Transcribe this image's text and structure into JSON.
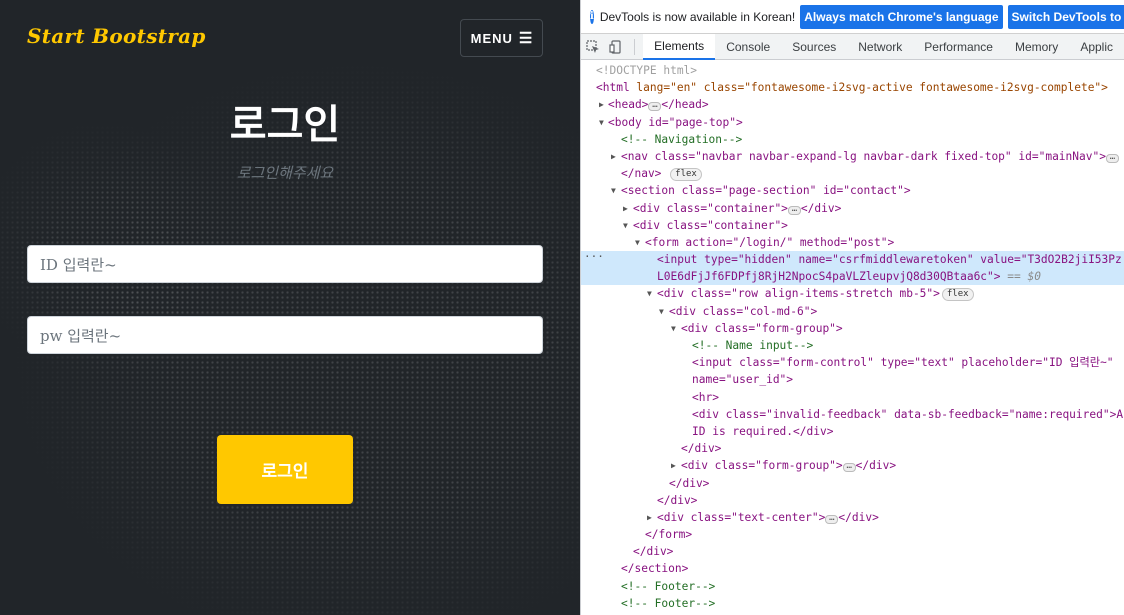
{
  "site": {
    "brand": "Start Bootstrap",
    "menu_label": "MENU",
    "menu_icon": "hamburger-icon",
    "title": "로그인",
    "subtitle": "로그인해주세요",
    "id_placeholder": "ID 입력란~",
    "pw_placeholder": "pw 입력란~",
    "login_button": "로그인",
    "colors": {
      "accent": "#ffc800",
      "background": "#212529"
    }
  },
  "devtools": {
    "infobar": {
      "message": "DevTools is now available in Korean!",
      "match_button": "Always match Chrome's language",
      "switch_button": "Switch DevTools to Ko"
    },
    "tabs": [
      "Elements",
      "Console",
      "Sources",
      "Network",
      "Performance",
      "Memory",
      "Applic"
    ],
    "active_tab": "Elements",
    "dom": {
      "l01": "<!DOCTYPE html>",
      "l02_tag": "<html",
      "l02_attrs": " lang=\"en\" class=\"fontawesome-i2svg-active fontawesome-i2svg-complete\">",
      "l03_open": "<head>",
      "l03_close": "</head>",
      "l04": "<body id=\"page-top\">",
      "l05": "<!-- Navigation-->",
      "l06": "<nav class=\"navbar navbar-expand-lg navbar-dark fixed-top\" id=\"mainNav\">",
      "l07": "</nav>",
      "flex": "flex",
      "l08": "<section class=\"page-section\" id=\"contact\">",
      "l09_open": "<div class=\"container\">",
      "l09_close": "</div>",
      "l10": "<div class=\"container\">",
      "l11": "<form action=\"/login/\" method=\"post\">",
      "l12a": "<input type=\"hidden\" name=\"csrfmiddlewaretoken\" value=\"T3dO2B2jiI53Pz",
      "l12b": "L0E6dFjJf6FDPfj8RjH2NpocS4paVLZleupvjQ8d30QBtaa6c\">",
      "l12_eq": " == $0",
      "l13": "<div class=\"row align-items-stretch mb-5\">",
      "l14": "<div class=\"col-md-6\">",
      "l15": "<div class=\"form-group\">",
      "l16": "<!-- Name input-->",
      "l17": "<input class=\"form-control\" type=\"text\" placeholder=\"ID 입력란~\"",
      "l18": "name=\"user_id\">",
      "l19": "<hr>",
      "l20": "<div class=\"invalid-feedback\" data-sb-feedback=\"name:required\">A",
      "l21": "ID is required.</div>",
      "l22": "</div>",
      "l23_open": "<div class=\"form-group\">",
      "l23_close": "</div>",
      "l24": "</div>",
      "l25": "</div>",
      "l26_open": "<div class=\"text-center\">",
      "l26_close": "</div>",
      "l27": "</form>",
      "l28": "</div>",
      "l29": "</section>",
      "l30": "<!-- Footer-->",
      "l31": "<!-- Footer-->"
    }
  }
}
